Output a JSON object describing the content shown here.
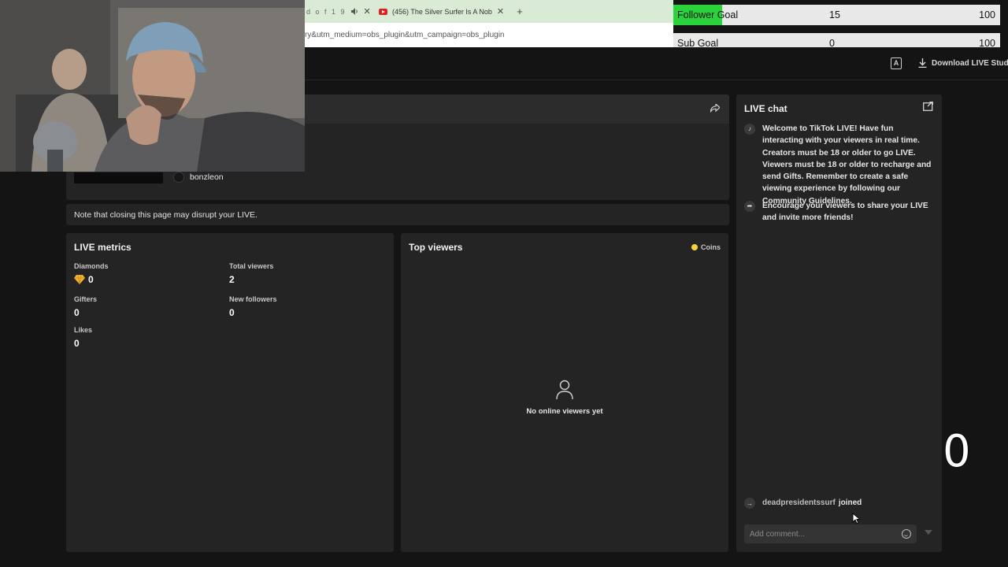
{
  "browser": {
    "tab1": "d o f 1 9",
    "tab2": "(456) The Silver Surfer Is A Nob",
    "tab_close": "✕",
    "tab_new": "+",
    "url": "ry&utm_medium=obs_plugin&utm_campaign=obs_plugin"
  },
  "goals": {
    "follower": {
      "label": "Follower Goal",
      "value": "15",
      "target": "100",
      "progress": 0.15
    },
    "sub": {
      "label": "Sub Goal",
      "value": "0",
      "target": "100",
      "progress": 0
    }
  },
  "topbar": {
    "download_label": "Download LIVE Studi"
  },
  "stream": {
    "username": "bonzleon"
  },
  "note": "Note that closing this page may disrupt your LIVE.",
  "metrics": {
    "title": "LIVE metrics",
    "diamonds_label": "Diamonds",
    "diamonds_value": "0",
    "total_viewers_label": "Total viewers",
    "total_viewers_value": "2",
    "gifters_label": "Gifters",
    "gifters_value": "0",
    "new_followers_label": "New followers",
    "new_followers_value": "0",
    "likes_label": "Likes",
    "likes_value": "0"
  },
  "top_viewers": {
    "title": "Top viewers",
    "coins_label": "Coins",
    "empty_text": "No online viewers yet"
  },
  "chat": {
    "title": "LIVE chat",
    "welcome": "Welcome to TikTok LIVE! Have fun interacting with your viewers in real time. Creators must be 18 or older to go LIVE. Viewers must be 18 or older to recharge and send Gifts. Remember to create a safe viewing experience by following our Community Guidelines.",
    "encourage": "Encourage your viewers to share your LIVE and invite more friends!",
    "joined_user": "deadpresidentssurf",
    "joined_text": "joined",
    "comment_placeholder": "Add comment..."
  },
  "overlay_count": "0",
  "colors": {
    "goal_fill": "#2ad33b",
    "coin": "#f4d23a",
    "page_bg": "#141414",
    "panel_bg": "#242424"
  }
}
